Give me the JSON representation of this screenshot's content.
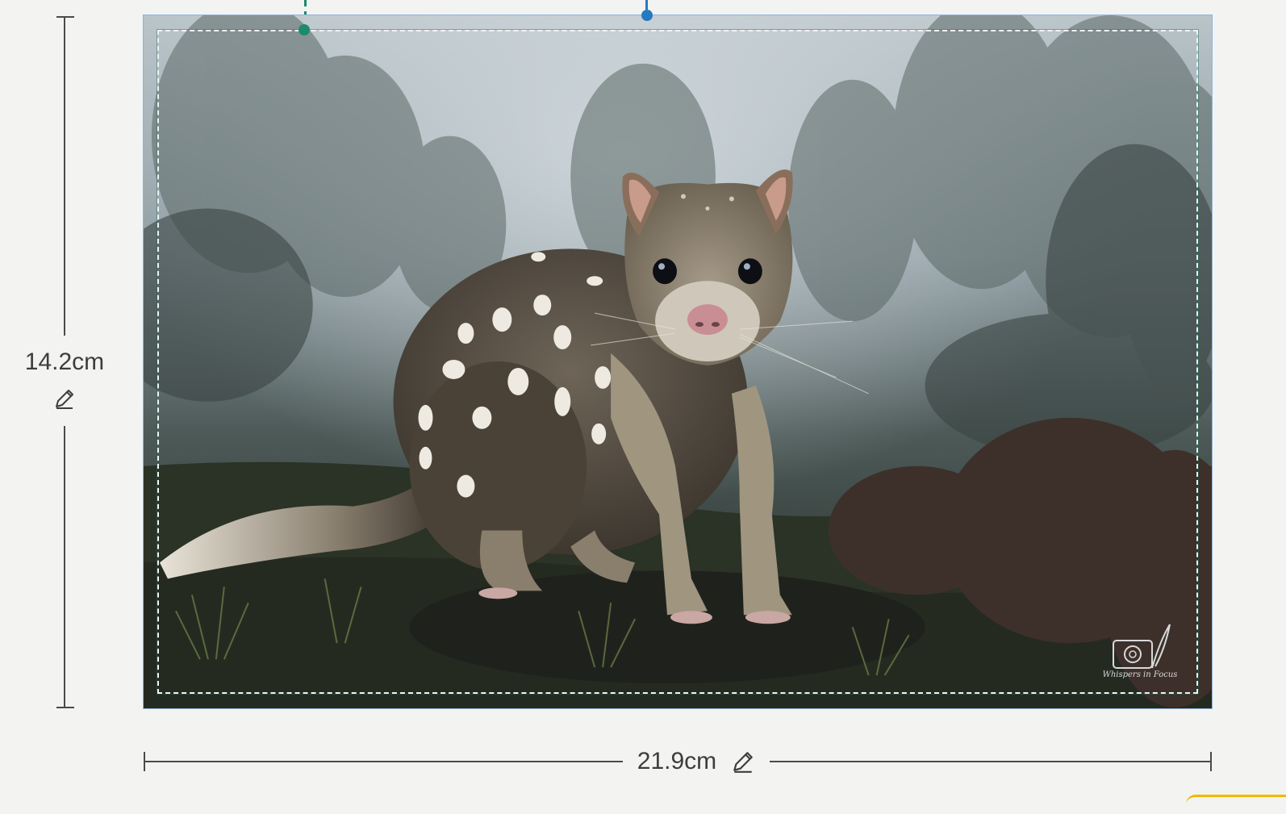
{
  "dimensions": {
    "height_label": "14.2cm",
    "width_label": "21.9cm"
  },
  "icons": {
    "edit_height": "pencil-icon",
    "edit_width": "pencil-icon"
  },
  "image": {
    "subject": "spotted quoll in misty forest",
    "watermark_text": "Whispers in Focus"
  },
  "colors": {
    "cut_line": "#f2f2f2",
    "safe_line": "#146e5a",
    "handle_green": "#1d8a6a",
    "handle_blue": "#2779c0",
    "frame_border": "#8fb3d6",
    "accent": "#f0b800"
  }
}
